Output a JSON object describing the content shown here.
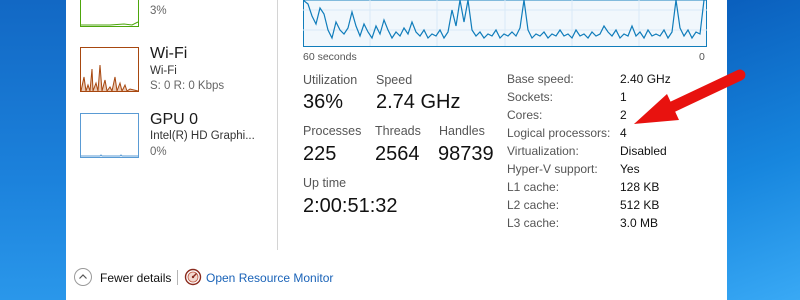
{
  "sidebar": {
    "items": [
      {
        "title": "",
        "line1": "3%",
        "line2": ""
      },
      {
        "title": "Wi-Fi",
        "line1": "Wi-Fi",
        "line2": "S: 0 R: 0 Kbps"
      },
      {
        "title": "GPU 0",
        "line1": "Intel(R) HD Graphi...",
        "line2": "0%"
      }
    ]
  },
  "graph": {
    "time_label": "60 seconds",
    "min_label": "0"
  },
  "stats": {
    "utilization": {
      "label": "Utilization",
      "value": "36%"
    },
    "speed": {
      "label": "Speed",
      "value": "2.74 GHz"
    },
    "processes": {
      "label": "Processes",
      "value": "225"
    },
    "threads": {
      "label": "Threads",
      "value": "2564"
    },
    "handles": {
      "label": "Handles",
      "value": "98739"
    },
    "uptime": {
      "label": "Up time",
      "value": "2:00:51:32"
    }
  },
  "specs": [
    {
      "label": "Base speed:",
      "value": "2.40 GHz"
    },
    {
      "label": "Sockets:",
      "value": "1"
    },
    {
      "label": "Cores:",
      "value": "2"
    },
    {
      "label": "Logical processors:",
      "value": "4"
    },
    {
      "label": "Virtualization:",
      "value": "Disabled"
    },
    {
      "label": "Hyper-V support:",
      "value": "Yes"
    },
    {
      "label": "L1 cache:",
      "value": "128 KB"
    },
    {
      "label": "L2 cache:",
      "value": "512 KB"
    },
    {
      "label": "L3 cache:",
      "value": "3.0 MB"
    }
  ],
  "footer": {
    "fewer_details": "Fewer details",
    "open_resource_monitor": "Open Resource Monitor"
  },
  "icons": {
    "fewer_details": "chevron-up-circle-icon",
    "resource_monitor": "resource-monitor-icon"
  },
  "colors": {
    "cpu_graph": "#117dbb",
    "wifi_graph": "#a7470f",
    "gpu_graph": "#5a9bd4",
    "disk_graph": "#4da60c",
    "link": "#1a63b8",
    "annotation_arrow": "#e8120f"
  }
}
